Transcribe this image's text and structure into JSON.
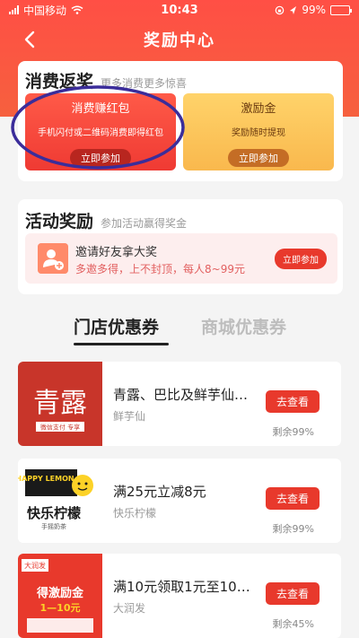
{
  "status_bar": {
    "carrier": "中国移动",
    "time": "10:43",
    "battery": "99%",
    "battery_level": 0.99
  },
  "nav": {
    "title": "奖励中心"
  },
  "rebate": {
    "title": "消费返奖",
    "subtitle": "更多消费更多惊喜",
    "red_card": {
      "title": "消费赚红包",
      "desc": "手机闪付或二维码消费即得红包",
      "button": "立即参加"
    },
    "yellow_card": {
      "title": "激励金",
      "desc": "奖励随时提现",
      "button": "立即参加"
    },
    "highlight_color": "#3b2d9a"
  },
  "activity": {
    "title": "活动奖励",
    "subtitle": "参加活动赢得奖金",
    "invite": {
      "title": "邀请好友拿大奖",
      "desc": "多邀多得，上不封顶，每人8~99元",
      "button": "立即参加"
    }
  },
  "tabs": {
    "active": "门店优惠券",
    "inactive": "商城优惠券"
  },
  "coupons": [
    {
      "name": "青露、巴比及鲜芋仙…",
      "merchant": "鲜芋仙",
      "button": "去查看",
      "remaining": "剩余99%",
      "logo_text": "青露",
      "logo_sub": "微信支付 专享"
    },
    {
      "name": "满25元立减8元",
      "merchant": "快乐柠檬",
      "button": "去查看",
      "remaining": "剩余99%",
      "logo_top": "HAPPY LEMON",
      "logo_text": "快乐柠檬",
      "logo_sub": "手摇奶茶"
    },
    {
      "name": "满10元领取1元至10元…",
      "merchant": "大润发",
      "button": "去查看",
      "remaining": "剩余45%",
      "logo_top": "大润发",
      "logo_text": "得激励金",
      "logo_amount": "1—10元"
    }
  ],
  "colors": {
    "brand_red": "#e8392c",
    "header_red": "#ff4f45",
    "promo_yellow": "#f9b84d"
  }
}
